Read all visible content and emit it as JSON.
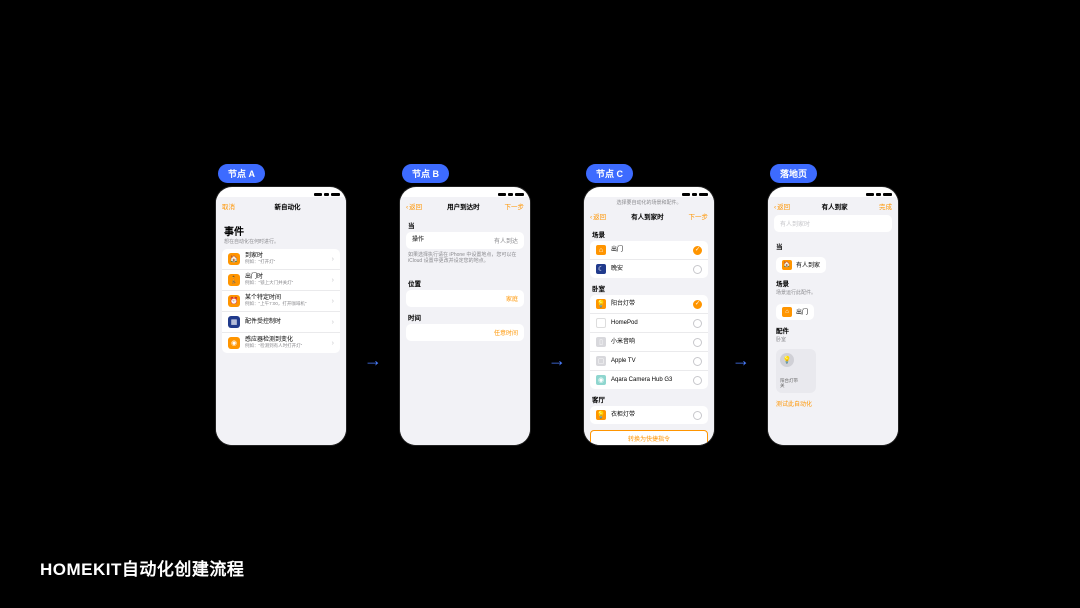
{
  "caption": "HOMEKIT自动化创建流程",
  "nodes": {
    "a": {
      "label": "节点 A",
      "nav": {
        "left": "取消",
        "title": "新自动化",
        "right": ""
      },
      "heading": "事件",
      "sub": "想在自动化在何时进行。",
      "rows": [
        {
          "icon": "person-arrive",
          "color": "ic-orange",
          "title": "到家时",
          "sub": "例如：\"打开灯\""
        },
        {
          "icon": "person-leave",
          "color": "ic-orange",
          "title": "出门时",
          "sub": "例如：\"锁上大门并关灯\""
        },
        {
          "icon": "clock",
          "color": "ic-orange",
          "title": "某个特定时间",
          "sub": "例如：\"上午7:00，打开咖啡机\""
        },
        {
          "icon": "grid",
          "color": "ic-navy",
          "title": "配件受控制时",
          "sub": ""
        },
        {
          "icon": "sensor",
          "color": "ic-orange",
          "title": "感应器检测到变化",
          "sub": "例如：\"检测到有人时打开灯\""
        }
      ]
    },
    "b": {
      "label": "节点 B",
      "nav": {
        "left": "返回",
        "title": "用户到达时",
        "right": "下一步"
      },
      "sec_when": "当",
      "row_op": {
        "title": "操作",
        "value": "有人到达"
      },
      "note": "如果选择执行请在 iPhone 中设置地点，您可以在 iCloud 设置中更改并设定您的地点。",
      "sec_loc": "位置",
      "loc_value": "家庭",
      "sec_time": "时间",
      "time_value": "任意时间"
    },
    "c": {
      "label": "节点 C",
      "nav": {
        "left": "返回",
        "title": "有人到家时",
        "right": "下一步"
      },
      "top_note": "选择要自动化的场景和配件。",
      "sec_scene": "场景",
      "scenes": [
        {
          "icon": "home-leave",
          "color": "ic-orange",
          "title": "出门",
          "on": true
        },
        {
          "icon": "moon",
          "color": "ic-navy",
          "title": "晚安",
          "on": false
        }
      ],
      "sec_bedroom": "卧室",
      "bedroom": [
        {
          "icon": "bulb",
          "color": "ic-orange",
          "title": "阳台灯带",
          "on": true
        },
        {
          "icon": "pod",
          "color": "ic-white",
          "title": "HomePod",
          "on": false
        },
        {
          "icon": "speaker",
          "color": "ic-grey",
          "title": "小米音响",
          "on": false
        },
        {
          "icon": "atv",
          "color": "ic-grey",
          "title": "Apple TV",
          "on": false
        },
        {
          "icon": "cam",
          "color": "ic-teal",
          "title": "Aqara Camera Hub G3",
          "on": false
        }
      ],
      "sec_living": "客厅",
      "living": [
        {
          "icon": "bulb",
          "color": "ic-orange",
          "title": "衣柜灯带",
          "on": false
        }
      ],
      "btn": "转换为快捷指令"
    },
    "d": {
      "label": "落地页",
      "nav": {
        "left": "返回",
        "title": "有人到家",
        "right": "完成"
      },
      "name_placeholder": "有人到家时",
      "sec_when": "当",
      "when_pill": {
        "icon": "person-arrive",
        "title": "有人到家"
      },
      "sec_scene": "场景",
      "scene_sub": "场景运行此配件。",
      "scene_pill": {
        "icon": "home-leave",
        "title": "出门"
      },
      "sec_acc": "配件",
      "acc_sub": "卧室",
      "acc_card": {
        "icon": "bulb",
        "title": "阳台灯带",
        "state": "关"
      },
      "test": "测试此自动化"
    }
  }
}
